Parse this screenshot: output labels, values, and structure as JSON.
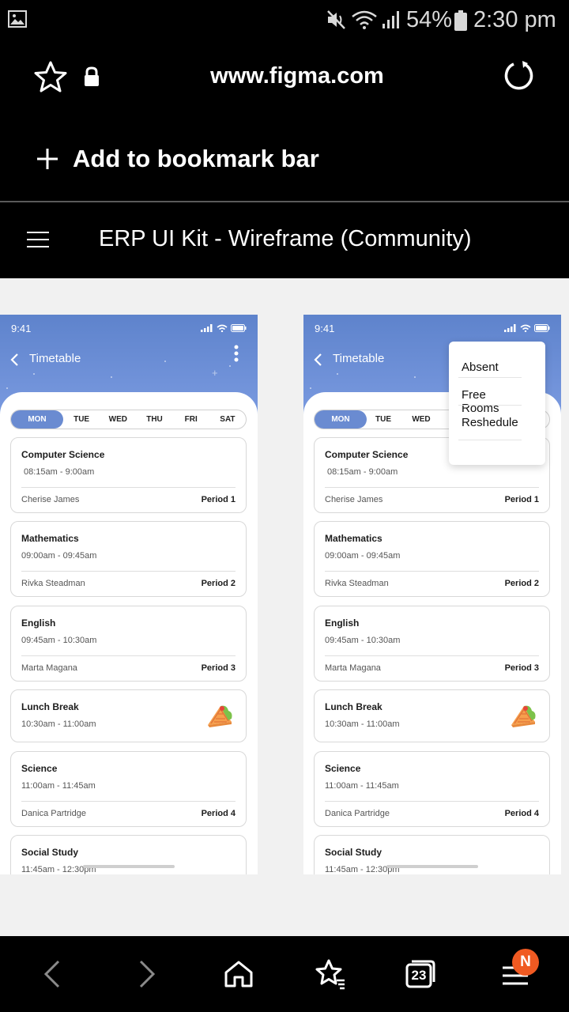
{
  "status_bar": {
    "battery_percent": "54%",
    "time": "2:30 pm"
  },
  "browser": {
    "url": "www.figma.com",
    "bookmark_label": "Add to bookmark bar"
  },
  "figma": {
    "file_title": "ERP UI Kit - Wireframe (Community)"
  },
  "frame_left": {
    "phone_time": "9:41",
    "title": "Timetable",
    "days": [
      "MON",
      "TUE",
      "WED",
      "THU",
      "FRI",
      "SAT"
    ],
    "cards": [
      {
        "subject": "Computer Science",
        "time": "08:15am - 9:00am",
        "teacher": "Cherise James",
        "period": "Period 1"
      },
      {
        "subject": "Mathematics",
        "time": "09:00am - 09:45am",
        "teacher": "Rivka Steadman",
        "period": "Period 2"
      },
      {
        "subject": "English",
        "time": "09:45am - 10:30am",
        "teacher": "Marta Magana",
        "period": "Period 3"
      },
      {
        "subject": "Lunch Break",
        "time": "10:30am - 11:00am"
      },
      {
        "subject": "Science",
        "time": "11:00am - 11:45am",
        "teacher": "Danica Partridge",
        "period": "Period 4"
      },
      {
        "subject": "Social Study",
        "time": "11:45am - 12:30pm"
      }
    ]
  },
  "frame_right": {
    "phone_time": "9:41",
    "title": "Timetable",
    "days": [
      "MON",
      "TUE",
      "WED"
    ],
    "menu": [
      "Absent",
      "Free Rooms",
      "Reshedule"
    ],
    "cards": [
      {
        "subject": "Computer Science",
        "time": "08:15am - 9:00am",
        "teacher": "Cherise James",
        "period": "Period 1"
      },
      {
        "subject": "Mathematics",
        "time": "09:00am - 09:45am",
        "teacher": "Rivka Steadman",
        "period": "Period 2"
      },
      {
        "subject": "English",
        "time": "09:45am - 10:30am",
        "teacher": "Marta Magana",
        "period": "Period 3"
      },
      {
        "subject": "Lunch Break",
        "time": "10:30am - 11:00am"
      },
      {
        "subject": "Science",
        "time": "11:00am - 11:45am",
        "teacher": "Danica Partridge",
        "period": "Period 4"
      },
      {
        "subject": "Social Study",
        "time": "11:45am - 12:30pm"
      }
    ]
  },
  "bottom_nav": {
    "badge": "N",
    "tab_count": "23",
    "icons": [
      "back-arrow-icon",
      "forward-arrow-icon",
      "home-icon",
      "bookmarks-star-icon",
      "tabs-icon",
      "menu-icon"
    ]
  },
  "colors": {
    "accent": "#6a8bd1",
    "header_gradient_top": "#5e83cc",
    "badge": "#f05a22"
  }
}
